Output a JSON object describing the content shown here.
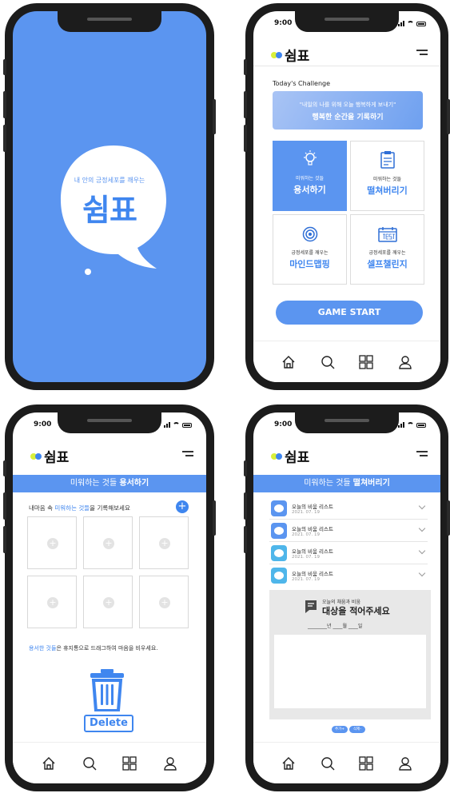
{
  "colors": {
    "brand_blue": "#5b95f0",
    "accent_blue": "#3f86ef",
    "logo_yellow": "#d9f03a",
    "frame": "#1c1c1c"
  },
  "splash": {
    "tagline": "내 안의 긍정세포를 깨우는",
    "logo": "쉼표"
  },
  "status": {
    "time": "9:00"
  },
  "app": {
    "logo": "쉼표"
  },
  "home": {
    "section_title": "Today's Challenge",
    "banner_line1": "\"내일의 나를 위해 오늘 행복하게 보내기\"",
    "banner_line2": "행복한 순간을 기록하기",
    "cards": [
      {
        "sub": "미워하는 것들",
        "title": "용서하기",
        "icon": "lightbulb-icon"
      },
      {
        "sub": "미워하는 것들",
        "title": "떨쳐버리기",
        "icon": "clipboard-icon"
      },
      {
        "sub": "긍정세포를 깨우는",
        "title": "마인드맵핑",
        "icon": "target-icon"
      },
      {
        "sub": "긍정세포를 깨우는",
        "title": "셀프챌린지",
        "icon": "test-calendar-icon"
      }
    ],
    "start_button": "GAME START"
  },
  "forgive": {
    "bar_prefix": "미워하는 것들 ",
    "bar_bold": "용서하기",
    "prompt_a": "내마음 속 ",
    "prompt_b": "미워하는 것들",
    "prompt_c": "을 기록해보세요",
    "hint_a": "용서한 것들",
    "hint_b": "은 휴지통으로 드래그하여 마음을 비우세요.",
    "delete_label": "Delete"
  },
  "discard": {
    "bar_prefix": "미워하는 것들 ",
    "bar_bold": "떨쳐버리기",
    "items": [
      {
        "title": "오늘의 비움 리스트",
        "date": "2021. 07. 19"
      },
      {
        "title": "오늘의 비움 리스트",
        "date": "2021. 07. 19"
      },
      {
        "title": "오늘의 비움 리스트",
        "date": "2021. 07. 19"
      },
      {
        "title": "오늘의 비움 리스트",
        "date": "2021. 07. 19"
      }
    ],
    "form_small": "오늘의 채움과 비움",
    "form_big": "대상을 적어주세요",
    "date_year": "년",
    "date_month": "월",
    "date_day": "일",
    "add_button": "추가+",
    "delete_button": "삭제-"
  },
  "tabs": [
    "home-icon",
    "search-icon",
    "grid-icon",
    "user-icon"
  ]
}
